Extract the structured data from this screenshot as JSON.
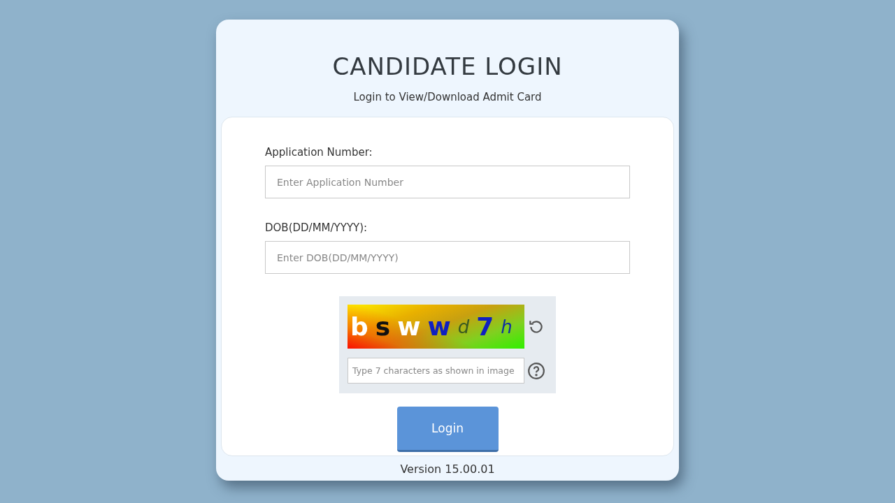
{
  "title": "CANDIDATE LOGIN",
  "subtitle": "Login to View/Download Admit Card",
  "fields": [
    {
      "label": "Application Number:",
      "placeholder": "Enter Application Number"
    },
    {
      "label": "DOB(DD/MM/YYYY):",
      "placeholder": "Enter DOB(DD/MM/YYYY)"
    }
  ],
  "captcha": {
    "characters": [
      {
        "text": "b",
        "color": "#ffffff",
        "kind": "bold"
      },
      {
        "text": "s",
        "color": "#111111",
        "kind": "bold"
      },
      {
        "text": "w",
        "color": "#ffffff",
        "kind": "bold"
      },
      {
        "text": "w",
        "color": "#1020c0",
        "kind": "bold"
      },
      {
        "text": "d",
        "color": "#3a5a20",
        "kind": "italic"
      },
      {
        "text": "7",
        "color": "#1020c0",
        "kind": "bold"
      },
      {
        "text": "h",
        "color": "#1030a0",
        "kind": "italic"
      }
    ],
    "placeholder": "Type 7 characters as shown in image"
  },
  "login_button": "Login",
  "version": "Version 15.00.01"
}
